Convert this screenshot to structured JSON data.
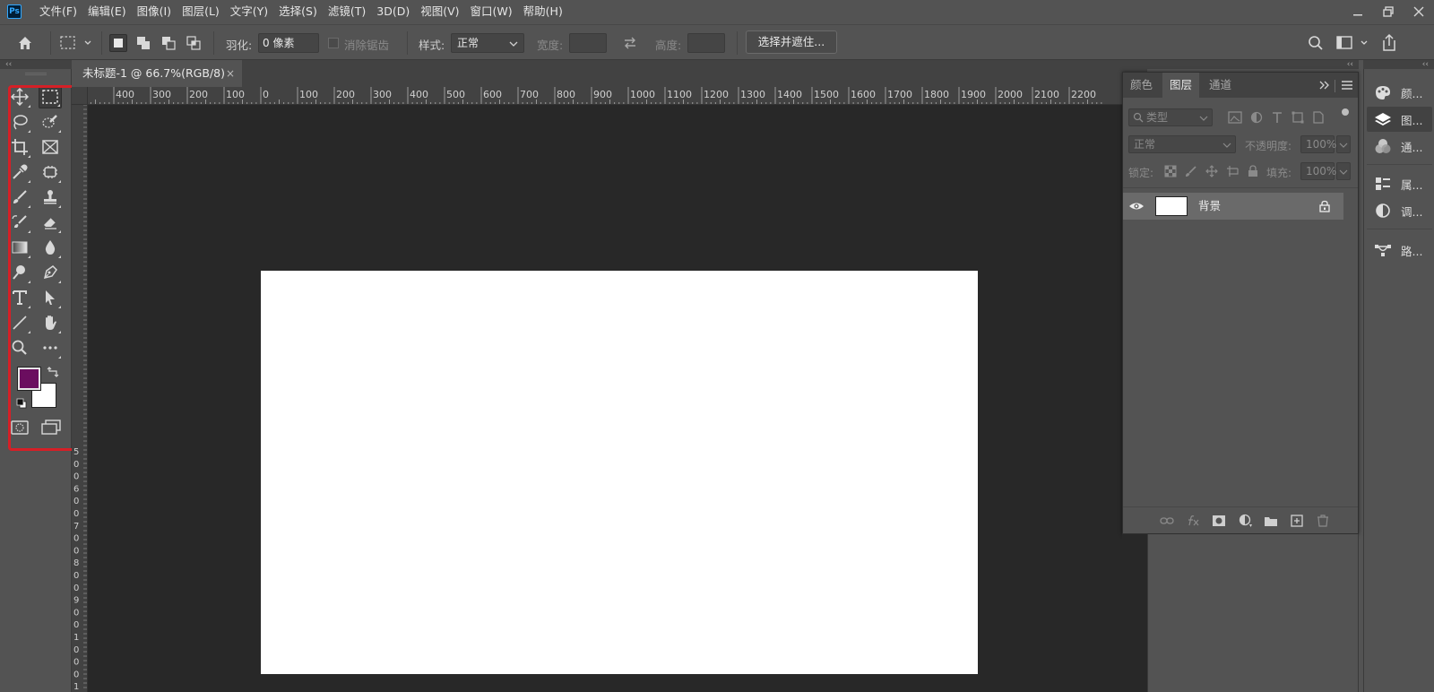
{
  "menubar": {
    "logo": "Ps",
    "items": [
      "文件(F)",
      "编辑(E)",
      "图像(I)",
      "图层(L)",
      "文字(Y)",
      "选择(S)",
      "滤镜(T)",
      "3D(D)",
      "视图(V)",
      "窗口(W)",
      "帮助(H)"
    ]
  },
  "options": {
    "feather_label": "羽化:",
    "feather_value": "0 像素",
    "antialias_label": "消除锯齿",
    "style_label": "样式:",
    "style_value": "正常",
    "width_label": "宽度:",
    "height_label": "高度:",
    "select_mask_button": "选择并遮住..."
  },
  "collapse": {
    "left": "‹‹",
    "panel": "‹‹",
    "dock": "‹‹"
  },
  "document": {
    "tab_title": "未标题-1 @ 66.7%(RGB/8)",
    "close": "×"
  },
  "ruler": {
    "top_labels": [
      "0",
      "400",
      "300",
      "200",
      "100",
      "0",
      "100",
      "200",
      "300",
      "400",
      "500",
      "600",
      "700",
      "800",
      "900",
      "1000",
      "1100",
      "1200",
      "1300",
      "1400",
      "1500",
      "1600",
      "1700",
      "1800",
      "1900",
      "2000",
      "2100",
      "2200"
    ],
    "left_labels": [
      "5",
      "0",
      "0",
      "6",
      "0",
      "0",
      "7",
      "0",
      "0",
      "8",
      "0",
      "0",
      "9",
      "0",
      "0",
      "1",
      "0",
      "0",
      "0",
      "1"
    ]
  },
  "colors": {
    "foreground": "#6b0d5f",
    "background": "#ffffff",
    "highlight": "#d61f26",
    "canvas_bg": "#282828"
  },
  "layers_panel": {
    "tabs": [
      "颜色",
      "图层",
      "通道"
    ],
    "active_tab": "图层",
    "filter_placeholder": "类型",
    "blend_mode": "正常",
    "opacity_label": "不透明度:",
    "opacity_value": "100%",
    "lock_label": "锁定:",
    "fill_label": "填充:",
    "fill_value": "100%",
    "layers": [
      {
        "name": "背景",
        "visible": true,
        "locked": true
      }
    ]
  },
  "right_dock": {
    "items": [
      {
        "label": "颜...",
        "icon": "color-palette-icon"
      },
      {
        "label": "图...",
        "icon": "layers-icon"
      },
      {
        "label": "通...",
        "icon": "channels-icon"
      },
      {
        "label": "属...",
        "icon": "properties-icon"
      },
      {
        "label": "调...",
        "icon": "adjustments-icon"
      },
      {
        "label": "路...",
        "icon": "paths-icon"
      }
    ]
  }
}
